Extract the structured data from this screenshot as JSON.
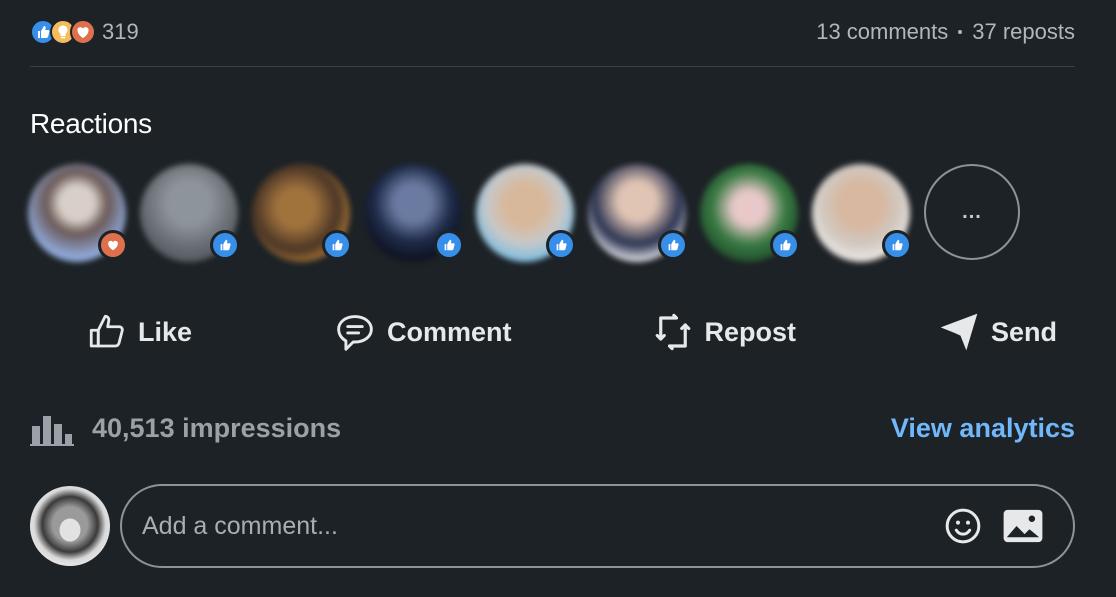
{
  "post_stats": {
    "reaction_icons": [
      "like-icon",
      "insightful-icon",
      "love-icon"
    ],
    "reaction_count": "319",
    "comments": "13 comments",
    "reposts": "37 reposts"
  },
  "reactions": {
    "title": "Reactions",
    "avatars": [
      {
        "badge": "love"
      },
      {
        "badge": "like"
      },
      {
        "badge": "like"
      },
      {
        "badge": "like"
      },
      {
        "badge": "like"
      },
      {
        "badge": "like"
      },
      {
        "badge": "like"
      },
      {
        "badge": "like"
      }
    ],
    "more_label": "..."
  },
  "actions": {
    "like": "Like",
    "comment": "Comment",
    "repost": "Repost",
    "send": "Send"
  },
  "analytics": {
    "impressions": "40,513 impressions",
    "view_link": "View analytics"
  },
  "comment_composer": {
    "placeholder": "Add a comment..."
  },
  "colors": {
    "background": "#1d2226",
    "like_blue": "#378fe9",
    "love_orange": "#df704d",
    "insight_yellow": "#f5bb5c",
    "link_blue": "#71b7fb"
  }
}
